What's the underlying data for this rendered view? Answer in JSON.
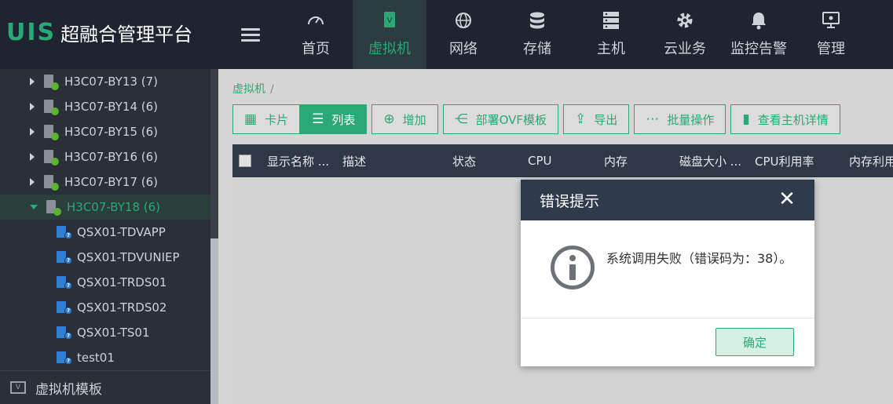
{
  "app": {
    "logo_mark": "UIS",
    "logo_text": "超融合管理平台"
  },
  "nav": {
    "items": [
      {
        "label": "首页",
        "icon": "speedometer-icon"
      },
      {
        "label": "虚拟机",
        "icon": "vm-icon",
        "active": true
      },
      {
        "label": "网络",
        "icon": "globe-icon"
      },
      {
        "label": "存储",
        "icon": "database-icon"
      },
      {
        "label": "主机",
        "icon": "server-icon"
      },
      {
        "label": "云业务",
        "icon": "gear-icon"
      },
      {
        "label": "监控告警",
        "icon": "bell-icon"
      },
      {
        "label": "管理",
        "icon": "monitor-icon"
      }
    ]
  },
  "sidebar": {
    "hosts": [
      {
        "label": "H3C07-BY13 (7)"
      },
      {
        "label": "H3C07-BY14 (6)"
      },
      {
        "label": "H3C07-BY15 (6)"
      },
      {
        "label": "H3C07-BY16 (6)"
      },
      {
        "label": "H3C07-BY17 (6)"
      },
      {
        "label": "H3C07-BY18 (6)",
        "expanded": true
      }
    ],
    "vms": [
      {
        "label": "QSX01-TDVAPP"
      },
      {
        "label": "QSX01-TDVUNIEP"
      },
      {
        "label": "QSX01-TRDS01"
      },
      {
        "label": "QSX01-TRDS02"
      },
      {
        "label": "QSX01-TS01"
      },
      {
        "label": "test01"
      }
    ],
    "bottom_label": "虚拟机模板",
    "bottom_icon_text": "V"
  },
  "main": {
    "breadcrumb": {
      "current": "虚拟机",
      "sep": "/"
    },
    "toolbar": {
      "card": "卡片",
      "list": "列表",
      "add": "增加",
      "deploy_ovf": "部署OVF模板",
      "export": "导出",
      "batch": "批量操作",
      "host_detail": "查看主机详情"
    },
    "table": {
      "columns": [
        "显示名称 ...",
        "描述",
        "状态",
        "CPU",
        "内存",
        "磁盘大小 ...",
        "CPU利用率",
        "内存利用"
      ]
    }
  },
  "modal": {
    "title": "错误提示",
    "close": "✕",
    "message": "系统调用失败（错误码为：38）。",
    "ok": "确定"
  },
  "colors": {
    "accent": "#2aa876",
    "topbar": "#1f2530",
    "sidebar": "#2a2f38",
    "table_head": "#2f3846"
  }
}
